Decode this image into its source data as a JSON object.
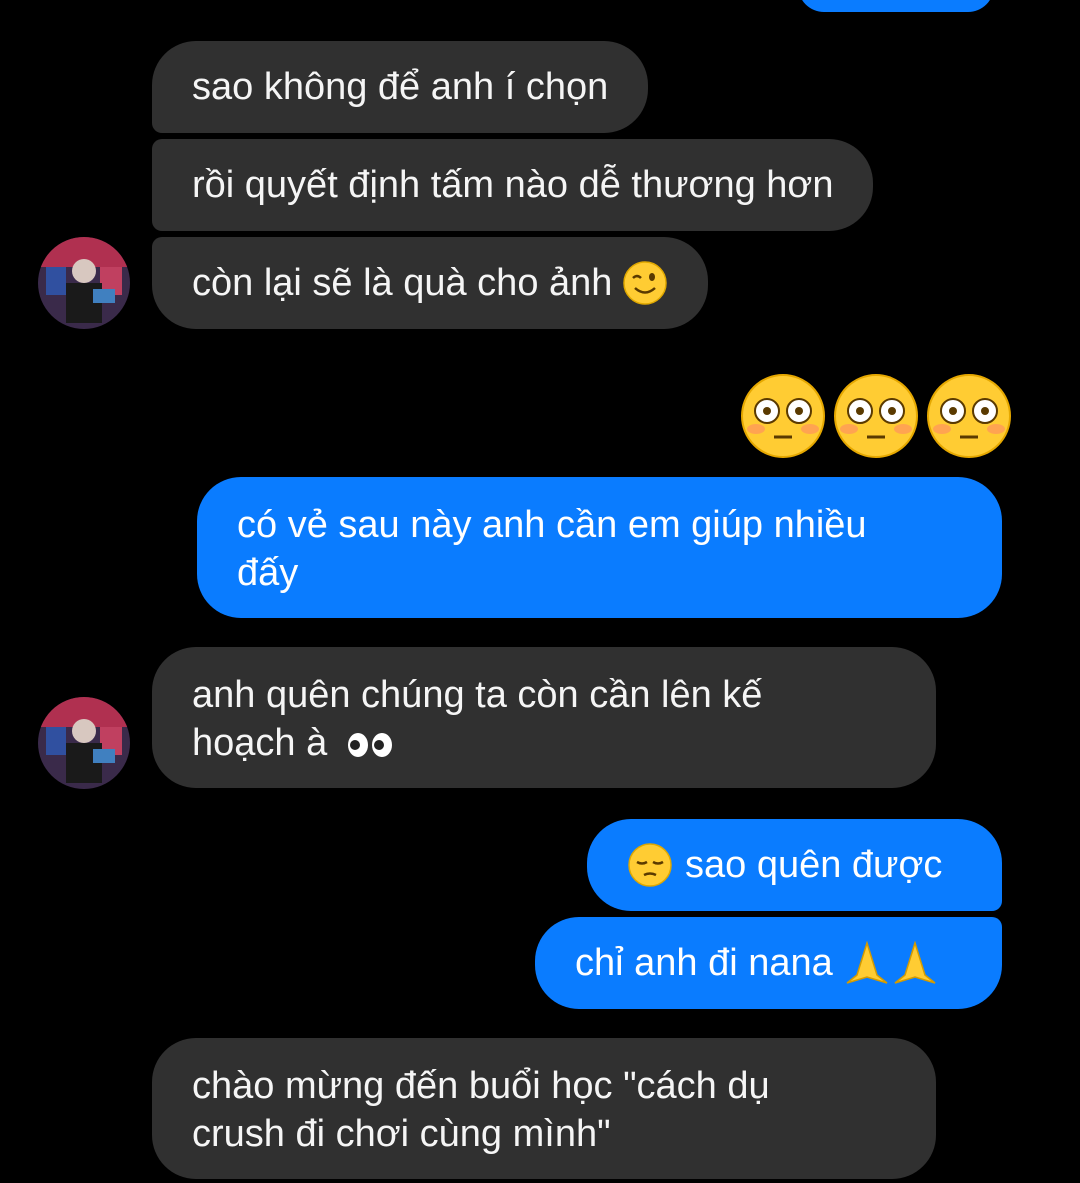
{
  "messages": [
    {
      "id": "m1",
      "dir": "in",
      "text": "sao không để anh í chọn"
    },
    {
      "id": "m2",
      "dir": "in",
      "text": "rồi quyết định tấm nào dễ thương hơn"
    },
    {
      "id": "m3",
      "dir": "in",
      "text": "còn lại sẽ là quà cho ảnh",
      "emoji": "wink-emoji"
    },
    {
      "id": "m4",
      "dir": "out",
      "emoji_only": [
        "flushed-emoji",
        "flushed-emoji",
        "flushed-emoji"
      ]
    },
    {
      "id": "m5",
      "dir": "out",
      "line1": "có vẻ sau này anh cần em giúp nhiều",
      "line2": "đấy"
    },
    {
      "id": "m6",
      "dir": "in",
      "line1": "anh quên chúng ta còn cần lên kế",
      "line2": "hoạch à",
      "emoji": "eyes-emoji"
    },
    {
      "id": "m7",
      "dir": "out",
      "text": "sao quên được",
      "emoji": "pensive-emoji"
    },
    {
      "id": "m8",
      "dir": "out",
      "text": "chỉ anh đi nana",
      "emoji": "folded-hands-emoji"
    },
    {
      "id": "m9",
      "dir": "in",
      "line1": "chào mừng đến buổi học \"cách dụ",
      "line2": "crush đi chơi cùng mình\""
    }
  ],
  "colors": {
    "background": "#000000",
    "incoming_bubble": "#303030",
    "outgoing_bubble": "#0a7cff",
    "text": "#ffffff"
  }
}
